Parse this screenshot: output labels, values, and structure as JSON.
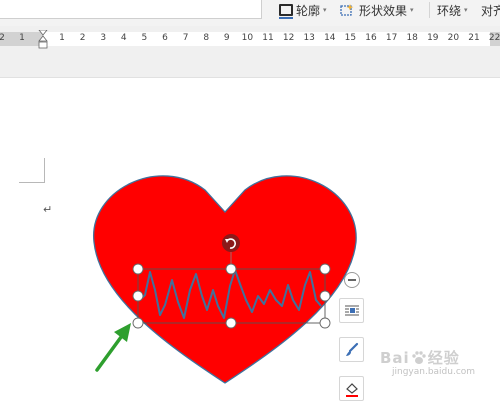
{
  "toolbar": {
    "outline_label": "轮廓",
    "shape_effects_label": "形状效果",
    "wrap_label": "环绕",
    "align_label": "对齐",
    "caret": "▾"
  },
  "ruler": {
    "left_labels": [
      "2",
      "1"
    ],
    "labels": [
      "1",
      "2",
      "3",
      "4",
      "5",
      "6",
      "7",
      "8",
      "9",
      "10",
      "11",
      "12",
      "13",
      "14",
      "15",
      "16",
      "17",
      "18",
      "19",
      "20",
      "21",
      "22"
    ]
  },
  "document": {
    "paragraph_mark": "↵"
  },
  "shapes": {
    "heart_color": "#ff0000",
    "heart_outline_color": "#41719c",
    "waveform_color": "#41719c",
    "rotate_handle_color": "#8b1a1a",
    "arrow_color": "#2e9f2e"
  },
  "watermark": {
    "brand_main": "Bai",
    "brand_cn": "经验",
    "url": "jingyan.baidu.com"
  }
}
